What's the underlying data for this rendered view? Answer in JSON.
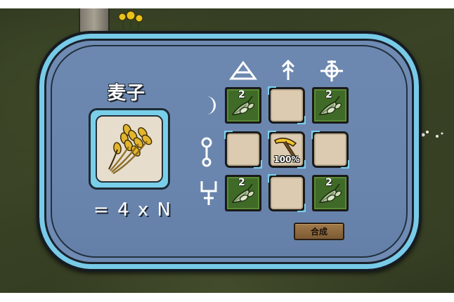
{
  "item": {
    "name": "麦子",
    "icon": "wheat-icon",
    "formula": "= 4 x N"
  },
  "grid": {
    "column_symbols": [
      "air-triangle-icon",
      "arrow-up-symbol-icon",
      "circle-cross-symbol-icon"
    ],
    "row_symbols": [
      "crescent-moon-icon",
      "circle-stem-symbol-icon",
      "trident-symbol-icon"
    ],
    "cells": [
      {
        "type": "ingredient",
        "icon": "seed-pile-icon",
        "count": "2"
      },
      {
        "type": "empty"
      },
      {
        "type": "ingredient",
        "icon": "seed-pile-icon",
        "count": "2"
      },
      {
        "type": "empty"
      },
      {
        "type": "tool",
        "icon": "pickaxe-icon",
        "percent": "100%"
      },
      {
        "type": "empty"
      },
      {
        "type": "ingredient",
        "icon": "seed-pile-icon",
        "count": "2"
      },
      {
        "type": "empty"
      },
      {
        "type": "ingredient",
        "icon": "seed-pile-icon",
        "count": "2"
      }
    ]
  },
  "craft_button": {
    "label": "合成"
  },
  "colors": {
    "panel": "#6f8bb4",
    "panel_border": "#78cbe8",
    "ingredient_cell": "#3f6a27",
    "empty_cell": "#dccbb0"
  }
}
